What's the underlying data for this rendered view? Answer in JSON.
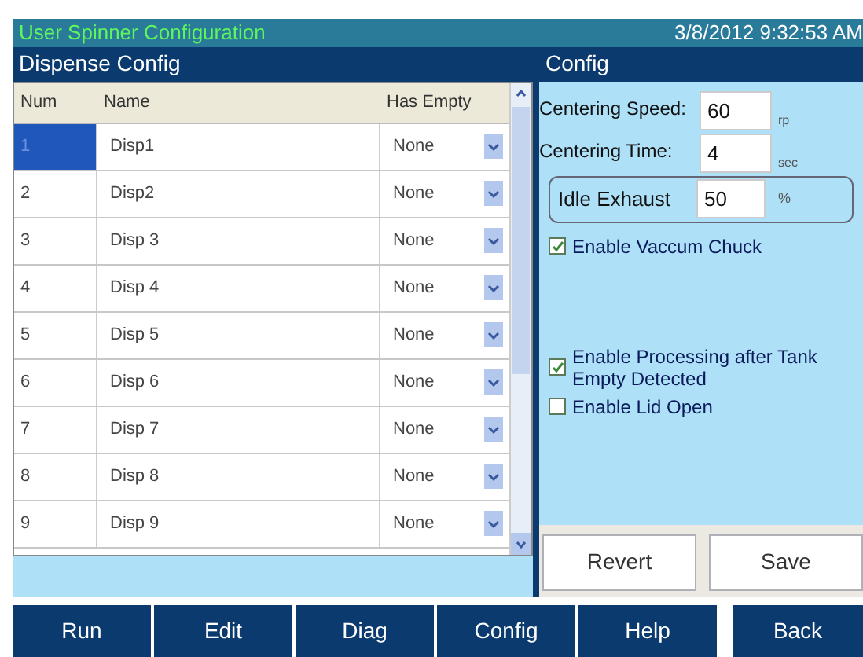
{
  "title_bar": {
    "title": "User Spinner Configuration",
    "datetime": "3/8/2012 9:32:53 AM"
  },
  "dispense_panel": {
    "title": "Dispense Config",
    "columns": [
      "Num",
      "Name",
      "Has Empty"
    ],
    "rows": [
      {
        "num": "1",
        "name": "Disp1",
        "has_empty": "None",
        "selected": true
      },
      {
        "num": "2",
        "name": "Disp2",
        "has_empty": "None",
        "selected": false
      },
      {
        "num": "3",
        "name": "Disp 3",
        "has_empty": "None",
        "selected": false
      },
      {
        "num": "4",
        "name": "Disp 4",
        "has_empty": "None",
        "selected": false
      },
      {
        "num": "5",
        "name": "Disp 5",
        "has_empty": "None",
        "selected": false
      },
      {
        "num": "6",
        "name": "Disp 6",
        "has_empty": "None",
        "selected": false
      },
      {
        "num": "7",
        "name": "Disp 7",
        "has_empty": "None",
        "selected": false
      },
      {
        "num": "8",
        "name": "Disp 8",
        "has_empty": "None",
        "selected": false
      },
      {
        "num": "9",
        "name": "Disp 9",
        "has_empty": "None",
        "selected": false
      }
    ]
  },
  "config_panel": {
    "title": "Config",
    "fields": [
      {
        "label": "Centering Speed:",
        "value": "60",
        "unit": "rp"
      },
      {
        "label": "Centering Time:",
        "value": "4",
        "unit": "sec"
      }
    ],
    "idle_exhaust": {
      "label": "Idle Exhaust",
      "value": "50",
      "unit": "%"
    },
    "checkboxes": [
      {
        "label": "Enable Vaccum Chuck",
        "checked": true
      },
      {
        "label": "Enable Processing after Tank Empty Detected",
        "checked": true
      },
      {
        "label": "Enable Lid Open",
        "checked": false
      }
    ],
    "buttons": [
      "Revert",
      "Save"
    ]
  },
  "nav": [
    "Run",
    "Edit",
    "Diag",
    "Config",
    "Help",
    "Back"
  ]
}
